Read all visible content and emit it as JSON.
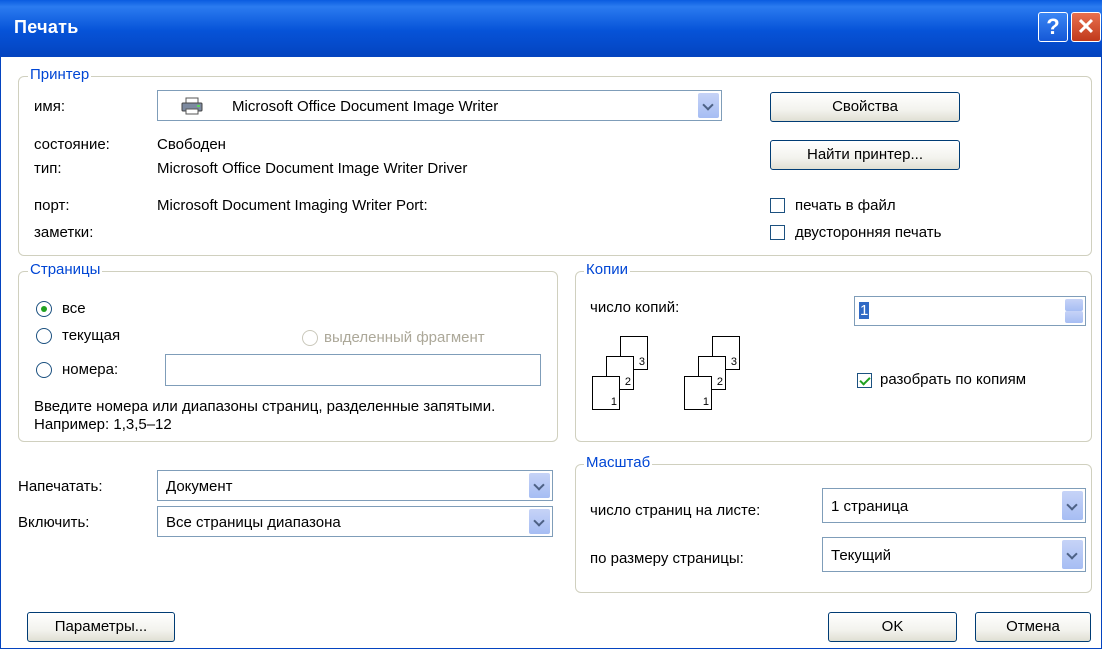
{
  "window": {
    "title": "Печать",
    "help_label": "?",
    "close_label": "✕"
  },
  "printer": {
    "legend": "Принтер",
    "name_label": "имя:",
    "name_value": "Microsoft Office Document Image Writer",
    "status_label": "состояние:",
    "status_value": "Свободен",
    "type_label": "тип:",
    "type_value": "Microsoft Office Document Image Writer Driver",
    "port_label": "порт:",
    "port_value": "Microsoft Document Imaging Writer Port:",
    "notes_label": "заметки:",
    "properties_button": "Свойства",
    "find_button": "Найти принтер...",
    "print_to_file": {
      "label": "печать в файл",
      "checked": false
    },
    "duplex": {
      "label": "двусторонняя печать",
      "checked": false
    }
  },
  "pages": {
    "legend": "Страницы",
    "all_label": "все",
    "current_label": "текущая",
    "selection_label": "выделенный фрагмент",
    "numbers_label": "номера:",
    "numbers_value": "",
    "hint": "Введите номера или диапазоны страниц, разделенные запятыми. Например: 1,3,5–12",
    "selected": "all"
  },
  "copies": {
    "legend": "Копии",
    "count_label": "число копий:",
    "count_value": "1",
    "collate": {
      "label": "разобрать по копиям",
      "checked": true
    },
    "page_numbers": [
      "1",
      "2",
      "3"
    ]
  },
  "print_what": {
    "label": "Напечатать:",
    "value": "Документ"
  },
  "include": {
    "label": "Включить:",
    "value": "Все страницы диапазона"
  },
  "zoom": {
    "legend": "Масштаб",
    "pages_per_sheet_label": "число страниц на листе:",
    "pages_per_sheet_value": "1 страница",
    "scale_label": "по размеру страницы:",
    "scale_value": "Текущий"
  },
  "footer": {
    "options_button": "Параметры...",
    "ok_button": "OK",
    "cancel_button": "Отмена"
  }
}
